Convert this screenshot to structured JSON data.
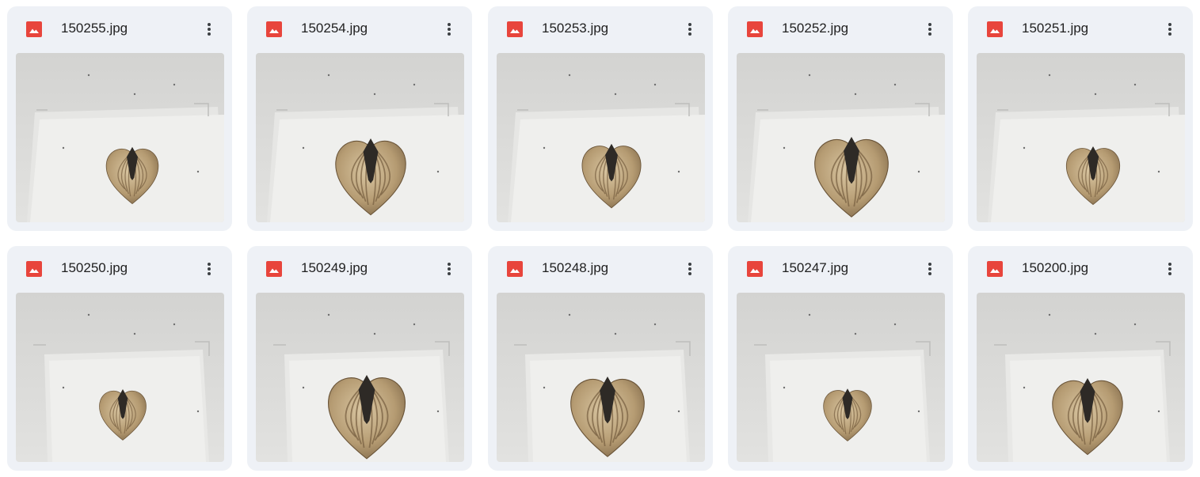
{
  "files": [
    {
      "name": "150255.jpg",
      "shell_scale": 0.78
    },
    {
      "name": "150254.jpg",
      "shell_scale": 1.05
    },
    {
      "name": "150253.jpg",
      "shell_scale": 0.88
    },
    {
      "name": "150252.jpg",
      "shell_scale": 1.1
    },
    {
      "name": "150251.jpg",
      "shell_scale": 0.8
    },
    {
      "name": "150250.jpg",
      "shell_scale": 0.7
    },
    {
      "name": "150249.jpg",
      "shell_scale": 1.15
    },
    {
      "name": "150248.jpg",
      "shell_scale": 1.1
    },
    {
      "name": "150247.jpg",
      "shell_scale": 0.72
    },
    {
      "name": "150200.jpg",
      "shell_scale": 1.05
    }
  ],
  "icons": {
    "file_type": "image-file-icon",
    "menu": "more-vert-icon"
  },
  "colors": {
    "card_bg": "#eef1f6",
    "image_icon": "#e8453c",
    "photo_bg": "#dcdcdc",
    "paper": "#efefed",
    "shell": "#b59b72",
    "hinge": "#2e2a26"
  }
}
